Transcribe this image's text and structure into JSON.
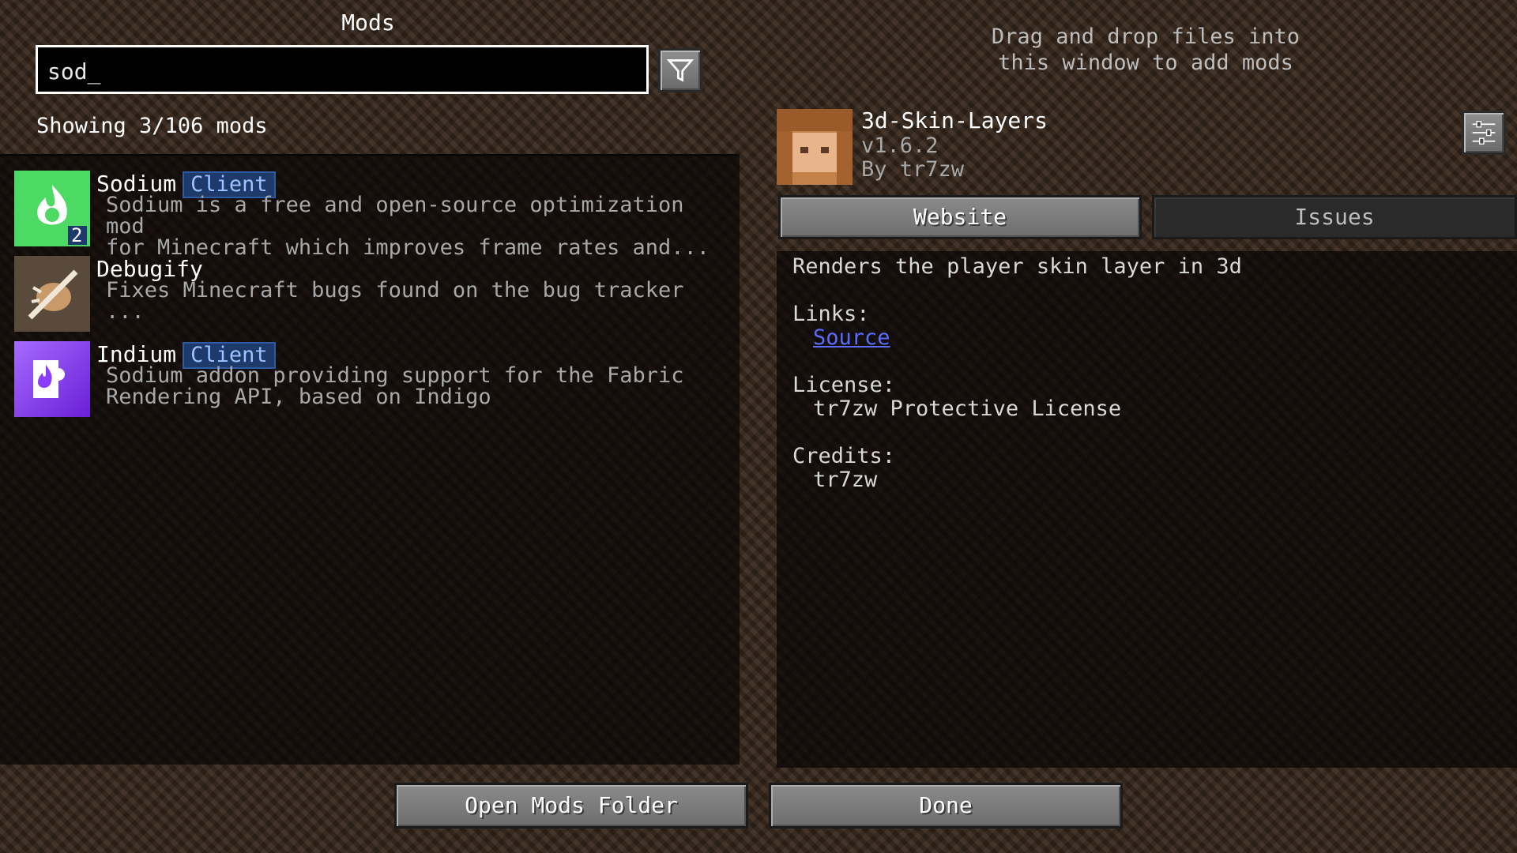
{
  "header": {
    "title": "Mods",
    "search_value": "sod_",
    "count_text": "Showing 3/106 mods",
    "drop_hint_line1": "Drag and drop files into",
    "drop_hint_line2": "this window to add mods"
  },
  "mods": [
    {
      "name": "Sodium",
      "badge": "Client",
      "desc_line1": "Sodium is a free and open-source optimization mod",
      "desc_line2": "for Minecraft which improves frame rates and...",
      "icon_badge_number": "2",
      "icon": "sodium-flame-icon",
      "icon_color": "#4cd964"
    },
    {
      "name": "Debugify",
      "badge": "",
      "desc_line1": "Fixes Minecraft bugs found on the bug tracker",
      "desc_line2": "...",
      "icon": "debugify-bug-icon",
      "icon_color": "#5a4a3c"
    },
    {
      "name": "Indium",
      "badge": "Client",
      "desc_line1": "Sodium addon providing support for the Fabric",
      "desc_line2": "Rendering API, based on Indigo",
      "icon": "indium-puzzle-icon",
      "icon_color": "#8a3cff"
    }
  ],
  "selected": {
    "name": "3d-Skin-Layers",
    "version": "v1.6.2",
    "author": "By tr7zw",
    "website_label": "Website",
    "issues_label": "Issues",
    "description": "Renders the player skin layer in 3d",
    "links_label": "Links:",
    "source_link": "Source",
    "license_label": "License:",
    "license_value": "tr7zw Protective License",
    "credits_label": "Credits:",
    "credits_value": "tr7zw"
  },
  "footer": {
    "open_folder_label": "Open Mods Folder",
    "done_label": "Done"
  },
  "colors": {
    "link": "#5a6bff",
    "badge_bg": "#1d3a6a",
    "badge_text": "#9cc3ff"
  }
}
